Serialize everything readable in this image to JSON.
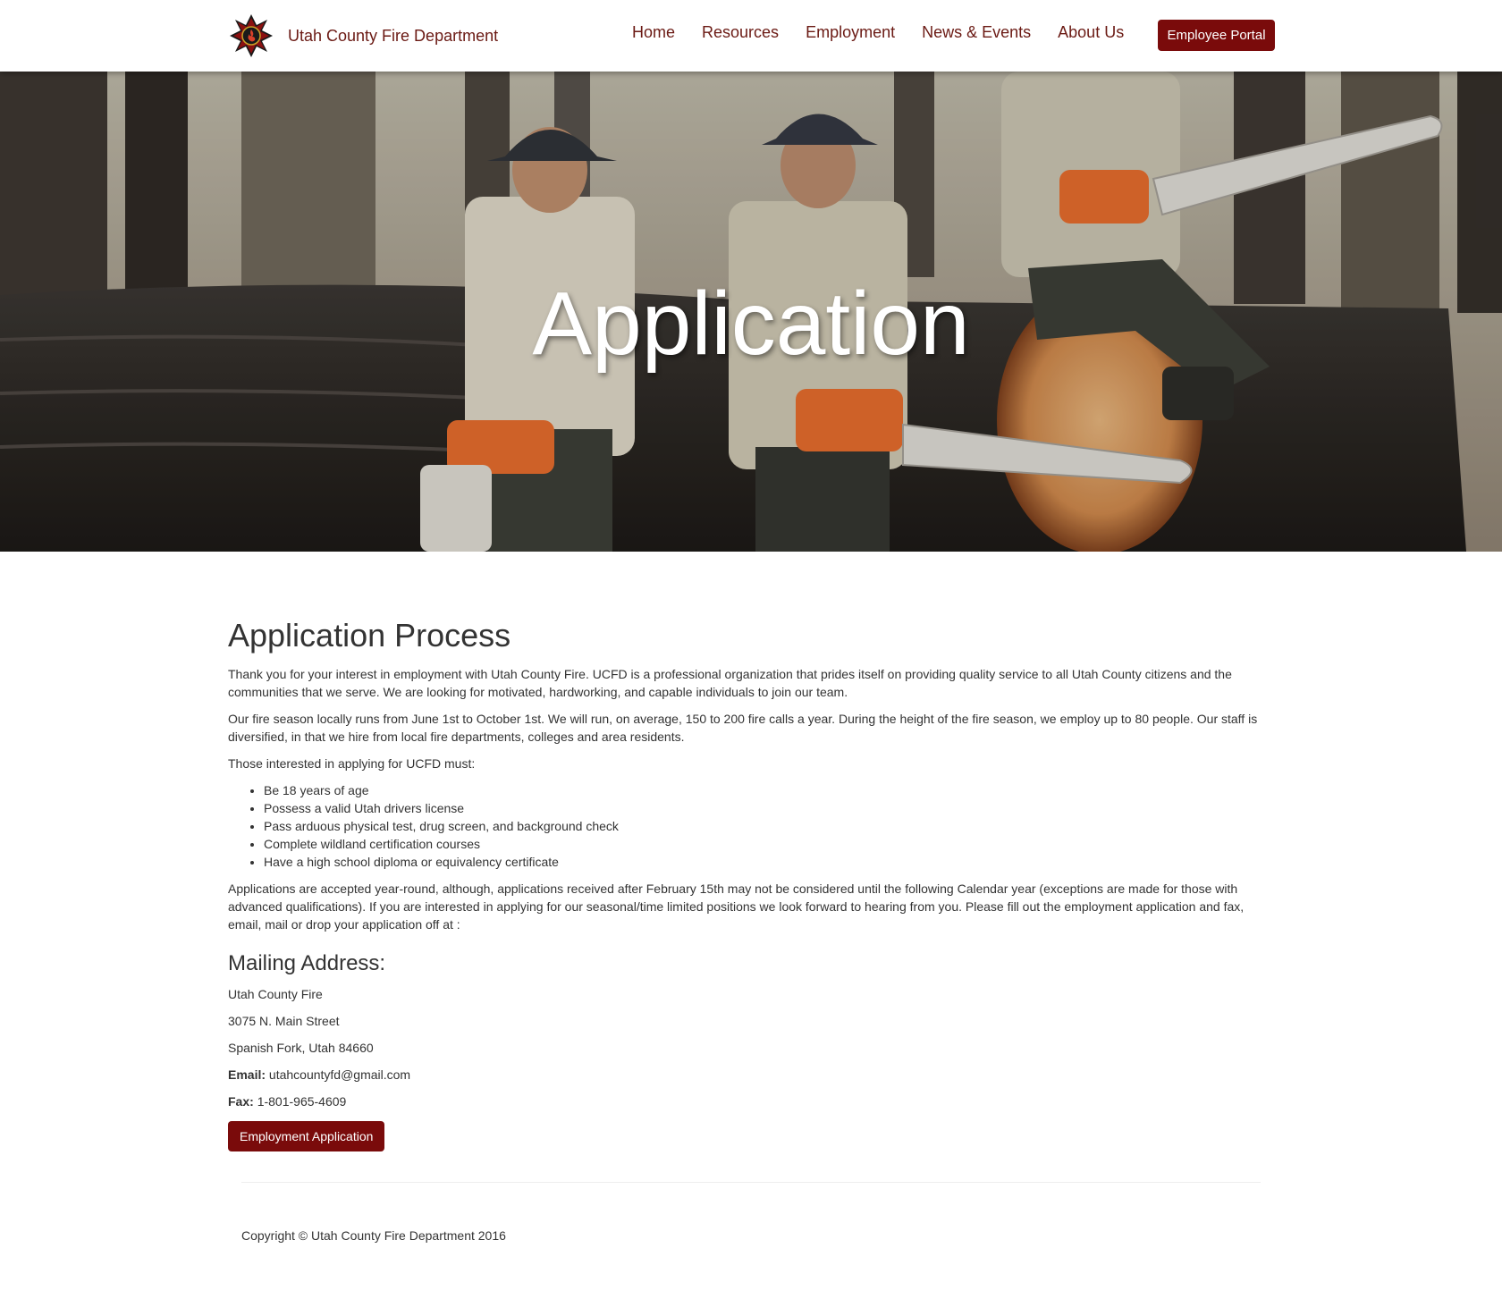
{
  "navbar": {
    "brand": "Utah County Fire Department",
    "logo_icon": "fire-department-cross-logo",
    "links": [
      "Home",
      "Resources",
      "Employment",
      "News & Events",
      "About Us"
    ],
    "portal_button": "Employee Portal"
  },
  "hero": {
    "title": "Application"
  },
  "main": {
    "heading": "Application Process",
    "intro": "Thank you for your interest in employment with Utah County Fire. UCFD is a professional organization that prides itself on providing quality service to all Utah County citizens and the communities that we serve. We are looking for motivated, hardworking, and capable individuals to join our team.",
    "season": "Our fire season locally runs from June 1st to October 1st. We will run, on average, 150 to 200 fire calls a year. During the height of the fire season, we employ up to 80 people. Our staff is diversified, in that we hire from local fire departments, colleges and area residents.",
    "requirements_intro": "Those interested in applying for UCFD must:",
    "requirements": [
      "Be 18 years of age",
      "Possess a valid Utah drivers license",
      "Pass arduous physical test, drug screen, and background check",
      "Complete wildland certification courses",
      "Have a high school diploma or equivalency certificate"
    ],
    "applications_note": "Applications are accepted year-round, although, applications received after February 15th may not be considered until the following Calendar year (exceptions are made for those with advanced qualifications). If you are interested in applying for our seasonal/time limited positions we look forward to hearing from you. Please fill out the employment application and fax, email, mail or drop your application off at :",
    "mailing_heading": "Mailing Address:",
    "address": {
      "line1": "Utah County Fire",
      "line2": "3075 N. Main Street",
      "line3": "Spanish Fork, Utah 84660",
      "email_label": "Email:",
      "email": "utahcountyfd@gmail.com",
      "fax_label": "Fax:",
      "fax": "1-801-965-4609"
    },
    "apply_button": "Employment Application"
  },
  "footer": {
    "copyright": "Copyright © Utah County Fire Department 2016"
  },
  "colors": {
    "brand": "#6b1a14",
    "button": "#7a0b0b"
  }
}
